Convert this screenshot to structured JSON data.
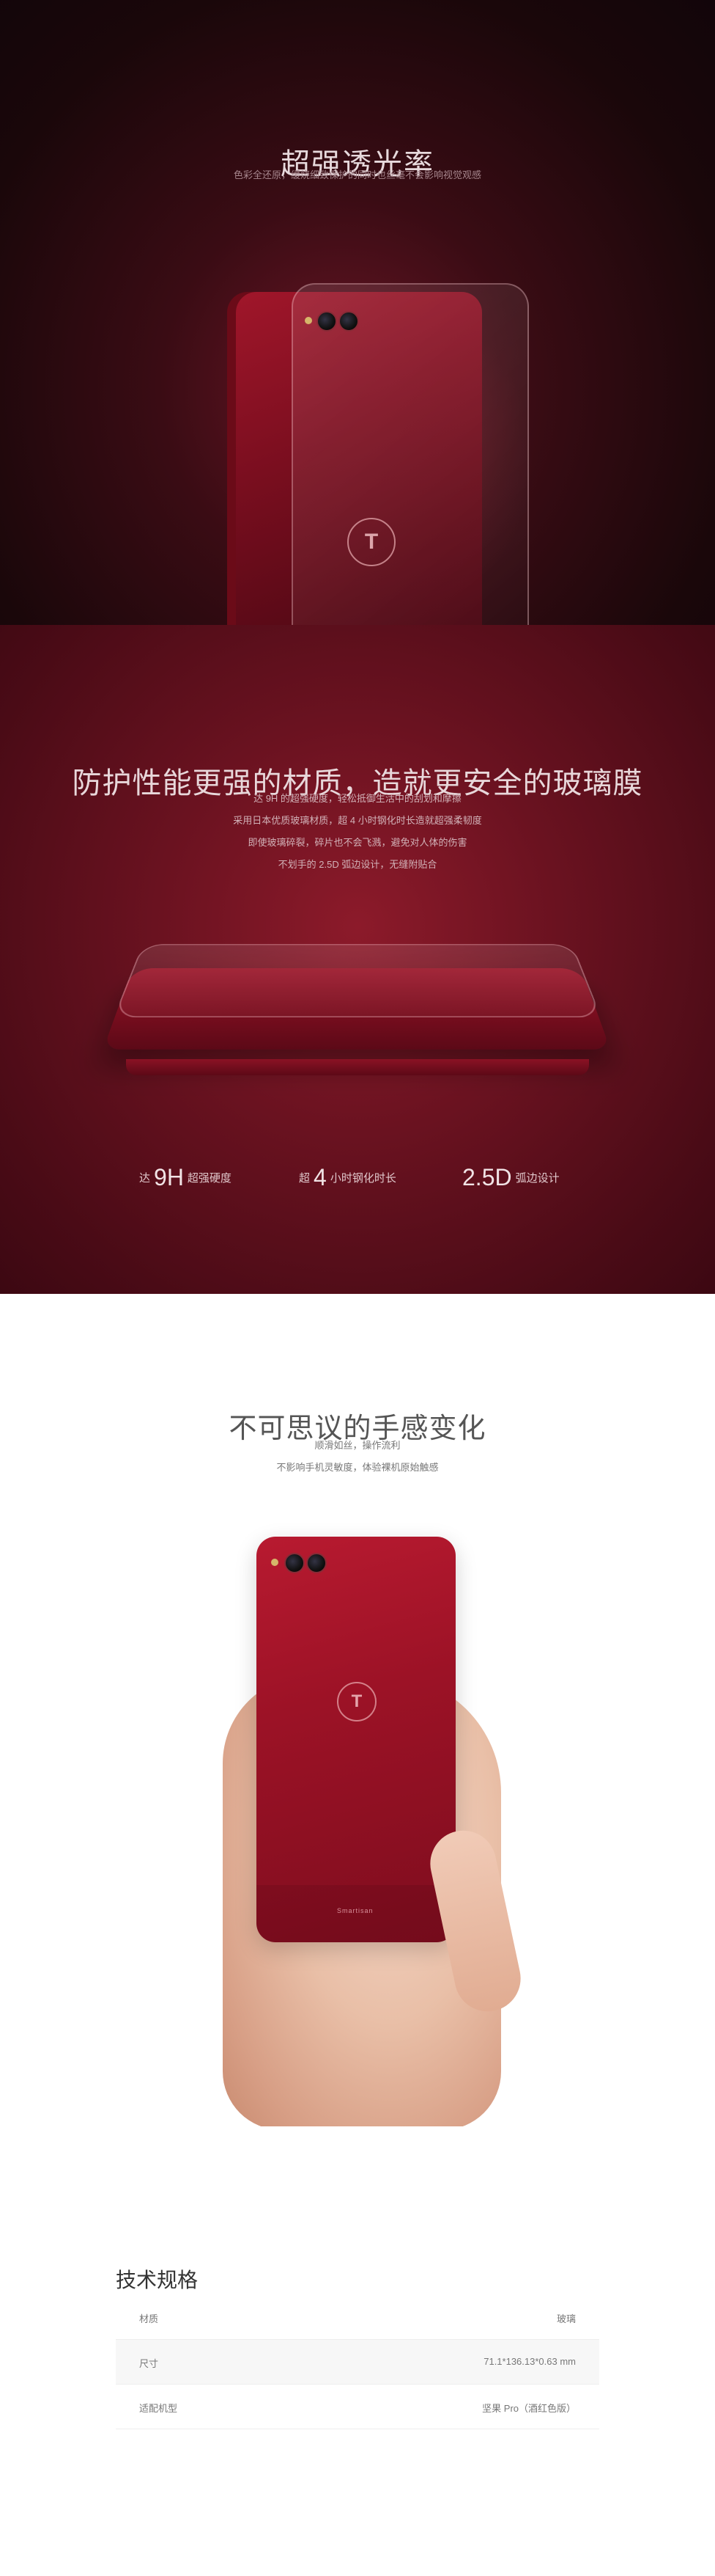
{
  "section_transmittance": {
    "title": "超强透光率",
    "subtitle": "色彩全还原，缓烧细致保护的同时也丝毫不会影响视觉观感",
    "logo_letter": "T"
  },
  "section_protection": {
    "title": "防护性能更强的材质，造就更安全的玻璃膜",
    "lines": [
      "达 9H 的超强硬度，轻松抵御生活中的刮划和摩擦",
      "采用日本优质玻璃材质，超 4 小时钢化时长造就超强柔韧度",
      "即使玻璃碎裂，碎片也不会飞溅，避免对人体的伤害",
      "不划手的 2.5D 弧边设计，无缝附贴合"
    ],
    "stats": [
      {
        "prefix": "达",
        "value": "9H",
        "suffix": "超强硬度"
      },
      {
        "prefix": "超",
        "value": "4",
        "suffix": "小时钢化时长"
      },
      {
        "prefix": "",
        "value": "2.5D",
        "suffix": "弧边设计"
      }
    ]
  },
  "section_feel": {
    "title": "不可思议的手感变化",
    "lines": [
      "顺滑如丝，操作流利",
      "不影响手机灵敏度，体验裸机原始触感"
    ],
    "logo_letter": "T",
    "brand_text": "Smartisan"
  },
  "specs": {
    "title": "技术规格",
    "rows": [
      {
        "label": "材质",
        "value": "玻璃"
      },
      {
        "label": "尺寸",
        "value": "71.1*136.13*0.63 mm"
      },
      {
        "label": "适配机型",
        "value": "坚果 Pro（酒红色版）"
      }
    ]
  },
  "colors": {
    "wine_dark": "#1a070a",
    "wine_mid": "#6a1220",
    "phone_red": "#9c1226"
  }
}
